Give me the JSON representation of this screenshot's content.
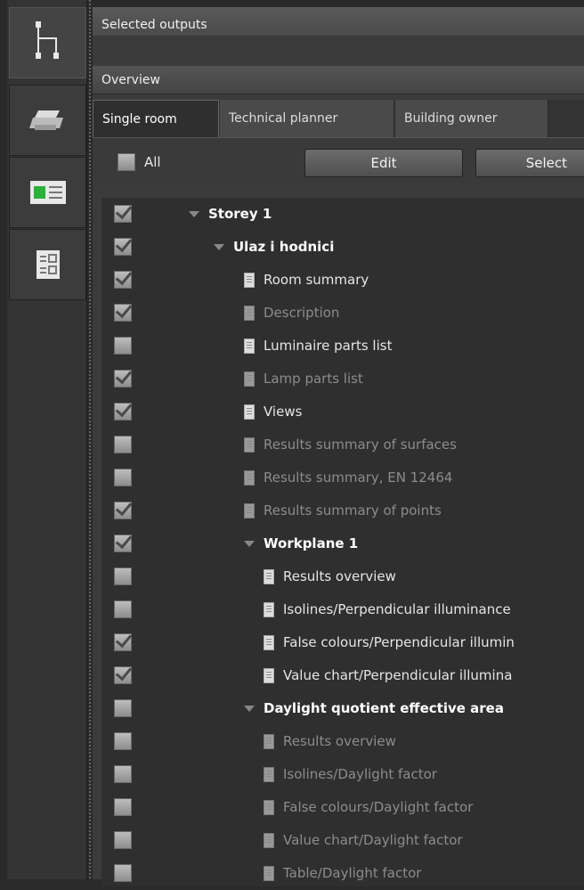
{
  "sidebar": {
    "buttons": [
      {
        "name": "project-tree-icon"
      },
      {
        "name": "printer-icon"
      },
      {
        "name": "output-list-icon"
      },
      {
        "name": "report-pages-icon"
      }
    ]
  },
  "header": {
    "title": "Selected outputs",
    "subtitle": "Overview"
  },
  "tabs": [
    {
      "label": "Single room",
      "active": true
    },
    {
      "label": "Technical planner",
      "active": false
    },
    {
      "label": "Building owner",
      "active": false
    }
  ],
  "toolbar": {
    "all_label": "All",
    "edit_label": "Edit",
    "select_label": "Select"
  },
  "tree": [
    {
      "label": "Storey 1",
      "level": 0,
      "type": "group",
      "checked": true,
      "bold": true,
      "dim": false
    },
    {
      "label": "Ulaz i hodnici",
      "level": 1,
      "type": "group",
      "checked": true,
      "bold": true,
      "dim": false
    },
    {
      "label": "Room summary",
      "level": 2,
      "type": "doc",
      "checked": true,
      "bold": false,
      "dim": false
    },
    {
      "label": "Description",
      "level": 2,
      "type": "doc",
      "checked": true,
      "bold": false,
      "dim": true
    },
    {
      "label": "Luminaire parts list",
      "level": 2,
      "type": "doc",
      "checked": false,
      "bold": false,
      "dim": false
    },
    {
      "label": "Lamp parts list",
      "level": 2,
      "type": "doc",
      "checked": true,
      "bold": false,
      "dim": true
    },
    {
      "label": "Views",
      "level": 2,
      "type": "doc",
      "checked": true,
      "bold": false,
      "dim": false
    },
    {
      "label": "Results summary of surfaces",
      "level": 2,
      "type": "doc",
      "checked": false,
      "bold": false,
      "dim": true
    },
    {
      "label": "Results summary, EN 12464",
      "level": 2,
      "type": "doc",
      "checked": false,
      "bold": false,
      "dim": true
    },
    {
      "label": "Results summary of points",
      "level": 2,
      "type": "doc",
      "checked": true,
      "bold": false,
      "dim": true
    },
    {
      "label": "Workplane 1",
      "level": 2,
      "type": "group",
      "checked": true,
      "bold": true,
      "dim": false
    },
    {
      "label": "Results overview",
      "level": 3,
      "type": "doc",
      "checked": false,
      "bold": false,
      "dim": false
    },
    {
      "label": "Isolines/Perpendicular illuminance",
      "level": 3,
      "type": "doc",
      "checked": false,
      "bold": false,
      "dim": false
    },
    {
      "label": "False colours/Perpendicular illumin",
      "level": 3,
      "type": "doc",
      "checked": true,
      "bold": false,
      "dim": false
    },
    {
      "label": "Value chart/Perpendicular illumina",
      "level": 3,
      "type": "doc",
      "checked": true,
      "bold": false,
      "dim": false
    },
    {
      "label": "Daylight quotient effective area",
      "level": 2,
      "type": "group",
      "checked": false,
      "bold": true,
      "dim": false
    },
    {
      "label": "Results overview",
      "level": 3,
      "type": "doc",
      "checked": false,
      "bold": false,
      "dim": true
    },
    {
      "label": "Isolines/Daylight factor",
      "level": 3,
      "type": "doc",
      "checked": false,
      "bold": false,
      "dim": true
    },
    {
      "label": "False colours/Daylight factor",
      "level": 3,
      "type": "doc",
      "checked": false,
      "bold": false,
      "dim": true
    },
    {
      "label": "Value chart/Daylight factor",
      "level": 3,
      "type": "doc",
      "checked": false,
      "bold": false,
      "dim": true
    },
    {
      "label": "Table/Daylight factor",
      "level": 3,
      "type": "doc",
      "checked": false,
      "bold": false,
      "dim": true
    }
  ]
}
